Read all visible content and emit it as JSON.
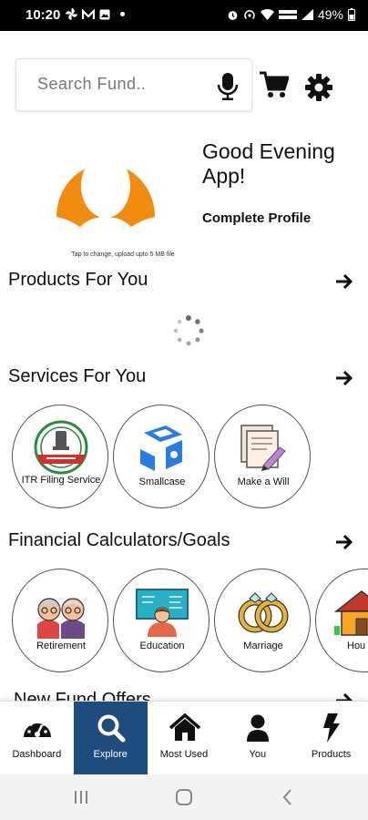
{
  "status": {
    "time": "10:20",
    "battery": "49%"
  },
  "search": {
    "placeholder": "Search Fund.."
  },
  "profile": {
    "greeting": "Good Evening App!",
    "complete_profile": "Complete Profile",
    "avatar_hint": "Tap to change, upload upto 5 MB file"
  },
  "sections": {
    "products": "Products For You",
    "services": "Services For You",
    "calculators": "Financial Calculators/Goals",
    "nfo": "New Fund Offers"
  },
  "services": [
    {
      "label": "ITR Filing Service",
      "icon": "income-tax-emblem-icon"
    },
    {
      "label": "Smallcase",
      "icon": "smallcase-logo-icon"
    },
    {
      "label": "Make a Will",
      "icon": "will-document-icon"
    }
  ],
  "calculators": [
    {
      "label": "Retirement",
      "icon": "elderly-couple-icon"
    },
    {
      "label": "Education",
      "icon": "education-board-icon"
    },
    {
      "label": "Marriage",
      "icon": "wedding-rings-icon"
    },
    {
      "label": "Hou",
      "icon": "house-icon"
    }
  ],
  "nav": [
    {
      "label": "Dashboard",
      "icon": "speedometer-icon",
      "active": false
    },
    {
      "label": "Explore",
      "icon": "search-icon",
      "active": true
    },
    {
      "label": "Most Used",
      "icon": "home-icon",
      "active": false
    },
    {
      "label": "You",
      "icon": "user-icon",
      "active": false
    },
    {
      "label": "Products",
      "icon": "lightning-icon",
      "active": false
    }
  ],
  "colors": {
    "accent_nav": "#1e4c7f",
    "avatar": "#f28c0f"
  }
}
